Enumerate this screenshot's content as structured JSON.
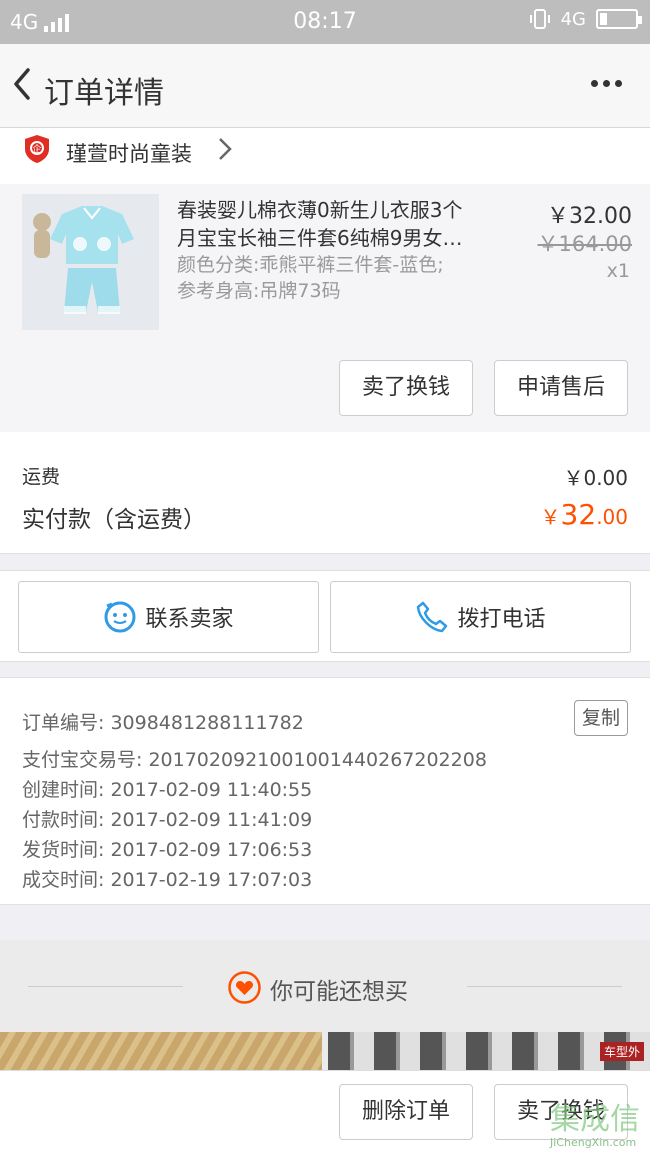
{
  "status_bar": {
    "signal_left": "4G",
    "time": "08:17",
    "signal_right": "4G"
  },
  "nav": {
    "title": "订单详情"
  },
  "shop": {
    "name": "瑾萱时尚童装"
  },
  "item": {
    "title_line1": "春装婴儿棉衣薄0新生儿衣服3个",
    "title_line2": "月宝宝长袖三件套6纯棉9男女…",
    "sku_line1": "颜色分类:乖熊平裤三件套-蓝色;",
    "sku_line2": "参考身高:吊牌73码",
    "price": "￥32.00",
    "original_price": "￥164.00",
    "quantity": "x1",
    "btn_resell": "卖了换钱",
    "btn_after_sale": "申请售后"
  },
  "fees": {
    "shipping_label": "运费",
    "shipping_value": "￥0.00",
    "paid_label": "实付款（含运费）",
    "paid_symbol": "￥",
    "paid_int": "32",
    "paid_dec": ".00"
  },
  "contact": {
    "seller": "联系卖家",
    "phone": "拨打电话"
  },
  "order_info": {
    "order_no": "订单编号: 3098481288111782",
    "copy": "复制",
    "alipay_no": "支付宝交易号: 2017020921001001440267202208",
    "created": "创建时间: 2017-02-09 11:40:55",
    "paid": "付款时间: 2017-02-09 11:41:09",
    "shipped": "发货时间: 2017-02-09 17:06:53",
    "completed": "成交时间: 2017-02-19 17:07:03"
  },
  "recommend": {
    "title": "你可能还想买",
    "thumb_tag": "车型外"
  },
  "bottom": {
    "delete_order": "删除订单",
    "resell": "卖了换钱"
  },
  "watermark": {
    "big": "集成信",
    "small": "JiChengXin.com"
  },
  "colors": {
    "accent": "#ff5000",
    "icon_blue": "#2f9be6"
  }
}
